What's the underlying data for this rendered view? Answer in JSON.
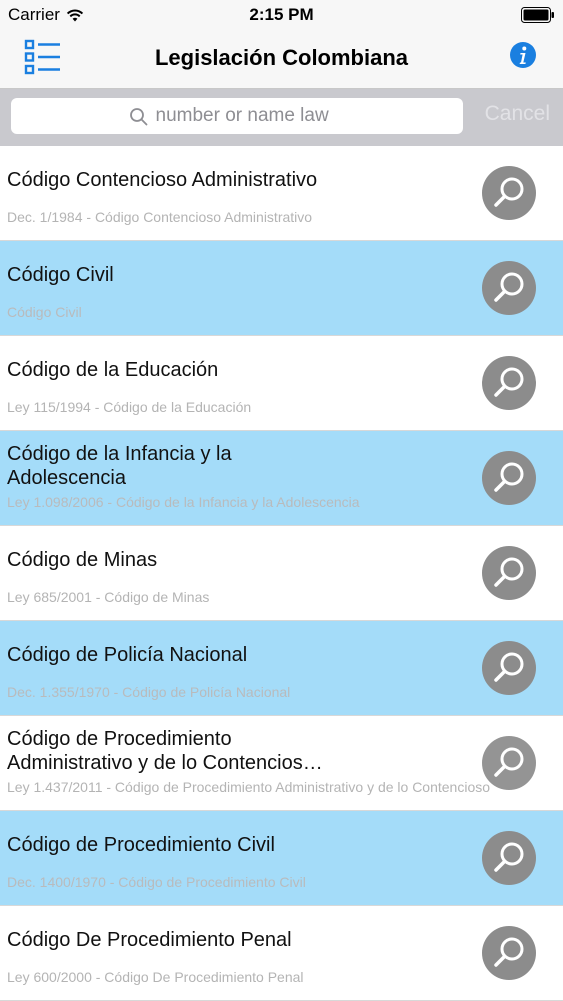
{
  "status_bar": {
    "carrier": "Carrier",
    "time": "2:15 PM"
  },
  "nav": {
    "title": "Legislación Colombiana",
    "menu_icon": "list-menu-icon",
    "info_icon": "info-icon"
  },
  "search": {
    "placeholder": "number or name law",
    "cancel_label": "Cancel"
  },
  "colors": {
    "accent": "#1a7fe0",
    "alt_row": "#a4dcf9",
    "button_gray": "#8c8c8c"
  },
  "laws": [
    {
      "title": "Código Contencioso Administrativo",
      "subtitle": "Dec. 1/1984 - Código Contencioso Administrativo"
    },
    {
      "title": "Código Civil",
      "subtitle": "Código Civil"
    },
    {
      "title": "Código de la Educación",
      "subtitle": "Ley 115/1994 - Código de la Educación"
    },
    {
      "title": "Código de la Infancia y la Adolescencia",
      "subtitle": "Ley 1.098/2006 - Código de la Infancia y la Adolescencia"
    },
    {
      "title": "Código de Minas",
      "subtitle": "Ley 685/2001 - Código de Minas"
    },
    {
      "title": "Código de Policía Nacional",
      "subtitle": "Dec. 1.355/1970 - Código de Policía Nacional"
    },
    {
      "title": "Código de Procedimiento Administrativo y de lo Contencios…",
      "subtitle": "Ley 1.437/2011 - Código de Procedimiento Administrativo y de lo Contencioso"
    },
    {
      "title": "Código de Procedimiento Civil",
      "subtitle": "Dec. 1400/1970 - Código de Procedimiento Civil"
    },
    {
      "title": "Código De Procedimiento Penal",
      "subtitle": "Ley 600/2000 - Código De Procedimiento Penal"
    }
  ]
}
